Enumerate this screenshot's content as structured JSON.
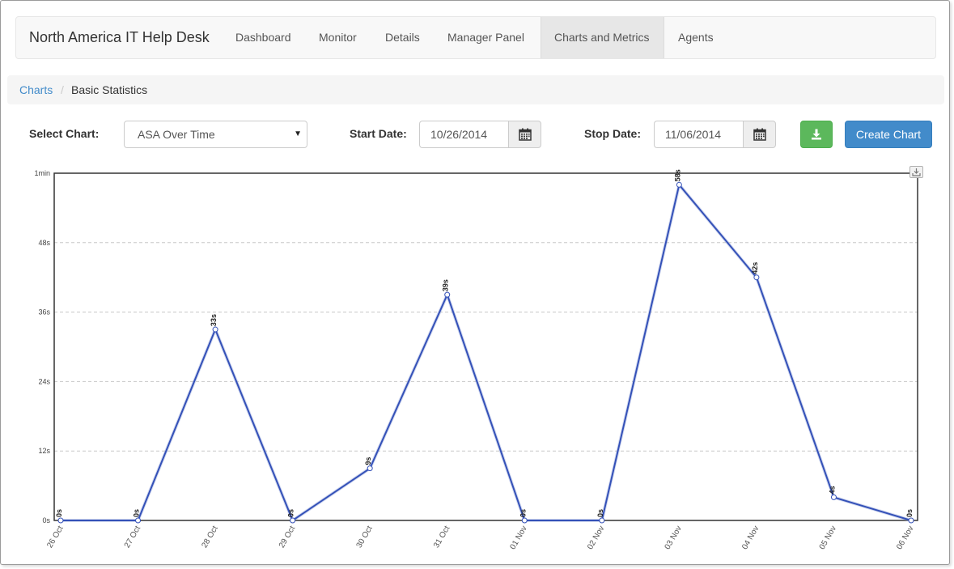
{
  "navbar": {
    "brand": "North America IT Help Desk",
    "items": [
      {
        "label": "Dashboard",
        "active": false
      },
      {
        "label": "Monitor",
        "active": false
      },
      {
        "label": "Details",
        "active": false
      },
      {
        "label": "Manager Panel",
        "active": false
      },
      {
        "label": "Charts and Metrics",
        "active": true
      },
      {
        "label": "Agents",
        "active": false
      }
    ]
  },
  "breadcrumb": {
    "link": "Charts",
    "separator": "/",
    "current": "Basic Statistics"
  },
  "controls": {
    "select_chart_label": "Select Chart:",
    "select_chart_value": "ASA Over Time",
    "start_date_label": "Start Date:",
    "start_date_value": "10/26/2014",
    "stop_date_label": "Stop Date:",
    "stop_date_value": "11/06/2014",
    "create_chart_label": "Create Chart",
    "download_icon": "download-icon",
    "calendar_icon": "calendar-icon"
  },
  "colors": {
    "line": "#3451b8",
    "green_button": "#5cb85c",
    "blue_button": "#428bca",
    "link": "#428bca"
  },
  "chart_data": {
    "type": "line",
    "title": "",
    "xlabel": "",
    "ylabel": "",
    "categories": [
      "26 Oct",
      "27 Oct",
      "28 Oct",
      "29 Oct",
      "30 Oct",
      "31 Oct",
      "01 Nov",
      "02 Nov",
      "03 Nov",
      "04 Nov",
      "05 Nov",
      "06 Nov"
    ],
    "values_seconds": [
      0,
      0,
      33,
      0,
      9,
      39,
      0,
      0,
      58,
      42,
      4,
      0
    ],
    "data_labels": [
      "0s",
      "0s",
      "33s",
      "0s",
      "9s",
      "39s",
      "0s",
      "0s",
      "58s",
      "42s",
      "4s",
      "0s"
    ],
    "ylim": [
      0,
      60
    ],
    "y_ticks": [
      0,
      12,
      24,
      36,
      48,
      60
    ],
    "y_tick_labels": [
      "0s",
      "12s",
      "24s",
      "36s",
      "48s",
      "1min"
    ],
    "grid": true,
    "legend": "none"
  }
}
